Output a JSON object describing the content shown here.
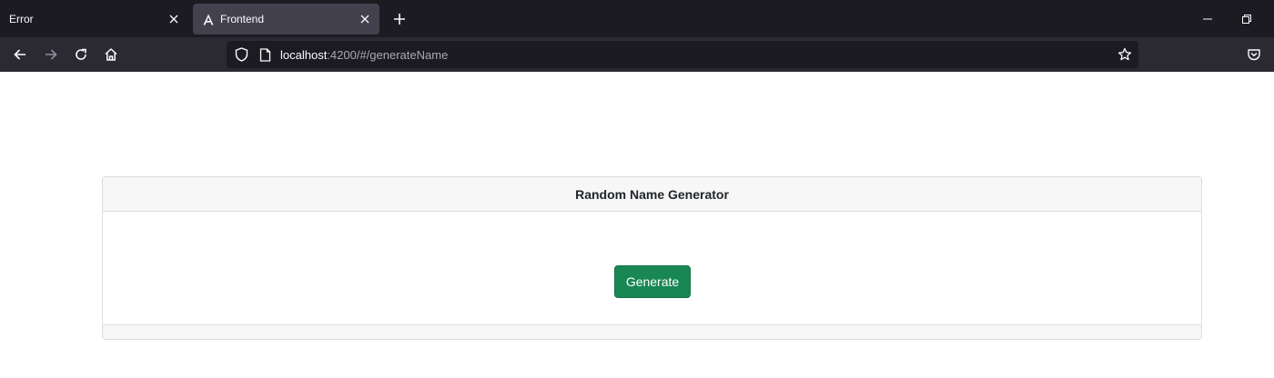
{
  "browser": {
    "tabs": [
      {
        "label": "Error",
        "active": false
      },
      {
        "label": "Frontend",
        "active": true
      }
    ],
    "url": {
      "host": "localhost",
      "rest": ":4200/#/generateName"
    }
  },
  "page": {
    "card": {
      "title": "Random Name Generator",
      "generate_label": "Generate"
    }
  },
  "colors": {
    "tabbar_bg": "#1c1b22",
    "navbar_bg": "#2b2a33",
    "active_tab_bg": "#42414d",
    "button_success": "#198754"
  }
}
